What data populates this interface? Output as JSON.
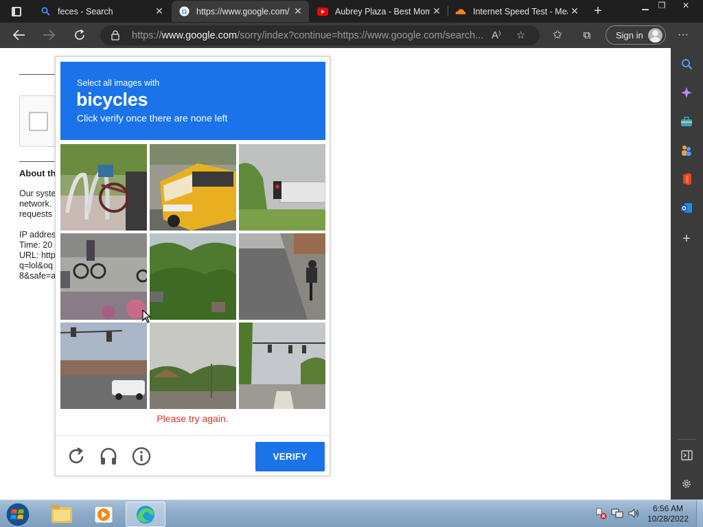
{
  "browser": {
    "tabs": [
      {
        "title": "feces - Search",
        "favicon": "search-icon",
        "active": false
      },
      {
        "title": "https://www.google.com/",
        "favicon": "google-icon",
        "active": true
      },
      {
        "title": "Aubrey Plaza - Best Mom",
        "favicon": "youtube-icon",
        "active": false
      },
      {
        "title": "Internet Speed Test - Mea",
        "favicon": "cloud-icon",
        "active": false
      }
    ],
    "address": {
      "prefix": "https://",
      "host": "www.google.com",
      "path": "/sorry/index?continue=https://www.google.com/search..."
    },
    "signin_label": "Sign in"
  },
  "page": {
    "about_heading": "About th",
    "para_lines": [
      "Our syste",
      "network.",
      "requests"
    ],
    "info_lines": [
      "IP addres",
      "Time: 20",
      "URL: http",
      "q=lol&oq",
      "8&safe=a"
    ]
  },
  "captcha": {
    "instruction_line1": "Select all images with",
    "target": "bicycles",
    "instruction_line3": "Click verify once there are none left",
    "error": "Please try again.",
    "verify_label": "VERIFY",
    "tiles": [
      {
        "row": 1,
        "col": 1,
        "content": "bike rack with bicycles"
      },
      {
        "row": 1,
        "col": 2,
        "content": "yellow school bus"
      },
      {
        "row": 1,
        "col": 3,
        "content": "traffic light"
      },
      {
        "row": 2,
        "col": 1,
        "content": "cyclists on street"
      },
      {
        "row": 2,
        "col": 2,
        "content": "trees"
      },
      {
        "row": 2,
        "col": 3,
        "content": "cyclist on road"
      },
      {
        "row": 3,
        "col": 1,
        "content": "traffic light and bridge"
      },
      {
        "row": 3,
        "col": 2,
        "content": "street with trees"
      },
      {
        "row": 3,
        "col": 3,
        "content": "intersection with traffic lights"
      }
    ]
  },
  "taskbar": {
    "time": "6:56 AM",
    "date": "10/28/2022"
  },
  "colors": {
    "captcha_blue": "#1a73e8",
    "error_red": "#d93025",
    "browser_dark": "#3b3b3b"
  }
}
